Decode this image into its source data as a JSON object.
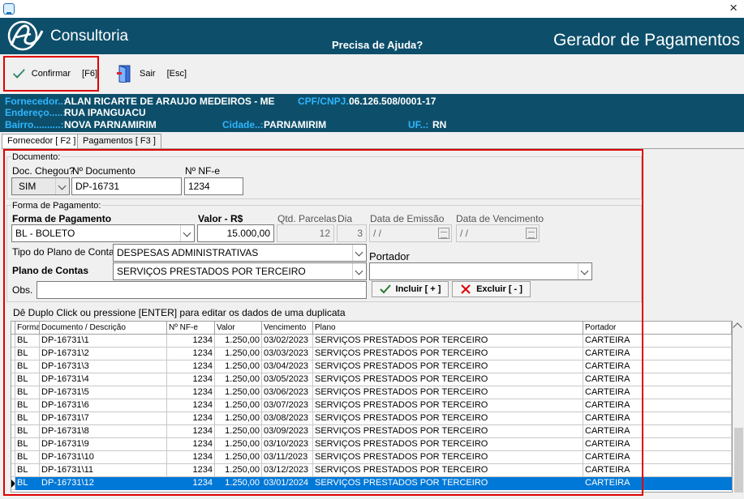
{
  "window": {
    "close_glyph": "×"
  },
  "header": {
    "brand": "Consultoria",
    "help": "Precisa de Ajuda?",
    "module_title": "Gerador de Pagamentos"
  },
  "toolbar": {
    "confirm_label": "Confirmar",
    "confirm_key": "[F6]",
    "exit_label": "Sair",
    "exit_key": "[Esc]"
  },
  "supplier": {
    "fornecedor_label": "Fornecedor..:",
    "fornecedor_value": "ALAN RICARTE DE ARAUJO MEDEIROS - ME",
    "cpf_label": "CPF/CNPJ.:",
    "cpf_value": "06.126.508/0001-17",
    "endereco_label": "Endereço.....:",
    "endereco_value": "RUA IPANGUACU",
    "bairro_label": "Bairro..........:",
    "bairro_value": "NOVA PARNAMIRIM",
    "cidade_label": "Cidade..:",
    "cidade_value": "PARNAMIRIM",
    "uf_label": "UF..:",
    "uf_value": "RN"
  },
  "tabs": [
    "Fornecedor [ F2 ]",
    "Pagamentos [ F3 ]"
  ],
  "documento": {
    "group_title": "Documento:",
    "doc_chegou_label": "Doc. Chegou?",
    "doc_chegou_value": "SIM",
    "n_documento_label": "Nº Documento",
    "n_documento_value": "DP-16731",
    "nf_label": "Nº NF-e",
    "nf_value": "1234"
  },
  "pagamento": {
    "group_title": "Forma de Pagamento:",
    "forma_label": "Forma de Pagamento",
    "forma_value": "BL - BOLETO",
    "valor_label": "Valor - R$",
    "valor_value": "15.000,00",
    "qtd_label": "Qtd. Parcelas",
    "qtd_value": "12",
    "dia_label": "Dia",
    "dia_value": "3",
    "emissao_label": "Data de Emissão",
    "emissao_value": " / /",
    "vencimento_label": "Data de Vencimento",
    "vencimento_value": " / /",
    "tipo_plano_label": "Tipo do Plano de Conta",
    "tipo_plano_value": "DESPESAS ADMINISTRATIVAS",
    "plano_label": "Plano de Contas",
    "plano_value": "SERVIÇOS PRESTADOS POR TERCEIRO",
    "portador_label": "Portador",
    "portador_value": "",
    "obs_label": "Obs.",
    "obs_value": "",
    "incluir_label": "Incluir [ + ]",
    "excluir_label": "Excluir [ - ]"
  },
  "grid": {
    "hint": "Dê Duplo Click ou pressione [ENTER] para editar os dados de uma duplicata",
    "columns": [
      "Forma",
      "Documento / Descrição",
      "Nº NF-e",
      "Valor",
      "Vencimento",
      "Plano",
      "Portador"
    ],
    "rows": [
      [
        "BL",
        "DP-16731\\1",
        "1234",
        "1.250,00",
        "03/02/2023",
        "SERVIÇOS PRESTADOS POR TERCEIRO",
        "CARTEIRA"
      ],
      [
        "BL",
        "DP-16731\\2",
        "1234",
        "1.250,00",
        "03/03/2023",
        "SERVIÇOS PRESTADOS POR TERCEIRO",
        "CARTEIRA"
      ],
      [
        "BL",
        "DP-16731\\3",
        "1234",
        "1.250,00",
        "03/04/2023",
        "SERVIÇOS PRESTADOS POR TERCEIRO",
        "CARTEIRA"
      ],
      [
        "BL",
        "DP-16731\\4",
        "1234",
        "1.250,00",
        "03/05/2023",
        "SERVIÇOS PRESTADOS POR TERCEIRO",
        "CARTEIRA"
      ],
      [
        "BL",
        "DP-16731\\5",
        "1234",
        "1.250,00",
        "03/06/2023",
        "SERVIÇOS PRESTADOS POR TERCEIRO",
        "CARTEIRA"
      ],
      [
        "BL",
        "DP-16731\\6",
        "1234",
        "1.250,00",
        "03/07/2023",
        "SERVIÇOS PRESTADOS POR TERCEIRO",
        "CARTEIRA"
      ],
      [
        "BL",
        "DP-16731\\7",
        "1234",
        "1.250,00",
        "03/08/2023",
        "SERVIÇOS PRESTADOS POR TERCEIRO",
        "CARTEIRA"
      ],
      [
        "BL",
        "DP-16731\\8",
        "1234",
        "1.250,00",
        "03/09/2023",
        "SERVIÇOS PRESTADOS POR TERCEIRO",
        "CARTEIRA"
      ],
      [
        "BL",
        "DP-16731\\9",
        "1234",
        "1.250,00",
        "03/10/2023",
        "SERVIÇOS PRESTADOS POR TERCEIRO",
        "CARTEIRA"
      ],
      [
        "BL",
        "DP-16731\\10",
        "1234",
        "1.250,00",
        "03/11/2023",
        "SERVIÇOS PRESTADOS POR TERCEIRO",
        "CARTEIRA"
      ],
      [
        "BL",
        "DP-16731\\11",
        "1234",
        "1.250,00",
        "03/12/2023",
        "SERVIÇOS PRESTADOS POR TERCEIRO",
        "CARTEIRA"
      ],
      [
        "BL",
        "DP-16731\\12",
        "1234",
        "1.250,00",
        "03/01/2024",
        "SERVIÇOS PRESTADOS POR TERCEIRO",
        "CARTEIRA"
      ]
    ],
    "selected_row": 11
  },
  "colors": {
    "header_bg": "#0d4f6b",
    "info_label": "#2fb6ff",
    "highlight": "#e00000",
    "selection": "#0078d7"
  }
}
